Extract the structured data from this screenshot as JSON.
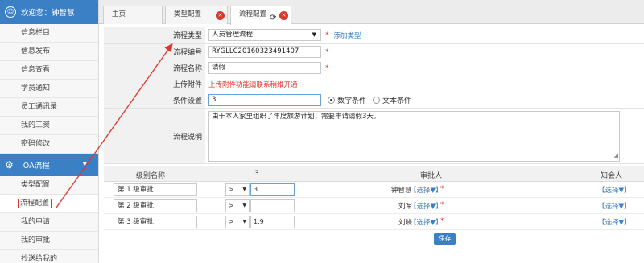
{
  "sidebar": {
    "welcome": "欢迎您：钟智慧",
    "items_top": [
      "信息栏目",
      "信息发布",
      "信息查看",
      "学员通知",
      "员工通讯录",
      "我的工资",
      "密码修改"
    ],
    "group_label": "OA流程",
    "items_bottom": [
      "类型配置",
      "流程配置",
      "我的申请",
      "我的审批",
      "抄送给我的"
    ]
  },
  "tabs": [
    {
      "label": "主页"
    },
    {
      "label": "类型配置"
    },
    {
      "label": "流程配置"
    }
  ],
  "form": {
    "type_label": "流程类型",
    "type_value": "人员管理流程",
    "add_type_link": "添加类型",
    "code_label": "流程编号",
    "code_value": "RYGLLC20160323491407",
    "name_label": "流程名称",
    "name_value": "请假",
    "attach_label": "上传附件",
    "attach_note": "上传附件功能请联系稍维开通",
    "cond_label": "条件设置",
    "cond_value": "3",
    "radio_numeric": "数字条件",
    "radio_text": "文本条件",
    "desc_label": "流程说明",
    "desc_value": "由于本人家里组织了年度旅游计划，需要申请请假3天。",
    "required_mark": "*"
  },
  "table": {
    "headers": {
      "level_name": "级别名称",
      "condition": "3",
      "approver": "审批人",
      "notify": "知会人"
    },
    "rows": [
      {
        "name": "第 1 级审批",
        "op": ">",
        "value": "3",
        "approver": "钟智慧",
        "pick": "【选择▼】",
        "notify_pick": "【选择▼】"
      },
      {
        "name": "第 2 级审批",
        "op": ">",
        "value": "",
        "approver": "刘军",
        "pick": "【选择▼】",
        "notify_pick": "【选择▼】"
      },
      {
        "name": "第 3 级审批",
        "op": ">",
        "value": "1.9",
        "approver": "刘晓",
        "pick": "【选择▼】",
        "notify_pick": "【选择▼】"
      }
    ],
    "save_label": "保存"
  },
  "colors": {
    "accent": "#3b7fc4",
    "alert": "#e0342c"
  }
}
